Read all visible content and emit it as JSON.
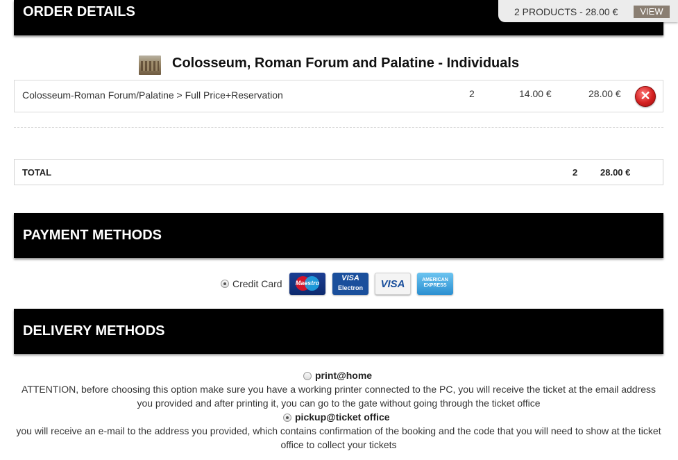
{
  "order_details": {
    "header": "ORDER DETAILS",
    "cart_summary": "2 PRODUCTS - 28.00 €",
    "view_button": "VIEW",
    "product_title": "Colosseum, Roman Forum and Palatine - Individuals",
    "line_item": {
      "description": "Colosseum-Roman Forum/Palatine > Full Price+Reservation",
      "quantity": "2",
      "unit_price": "14.00 €",
      "total": "28.00 €",
      "remove_icon": "remove-x-icon"
    },
    "totals": {
      "label": "TOTAL",
      "quantity": "2",
      "amount": "28.00 €"
    }
  },
  "payment_methods": {
    "header": "PAYMENT METHODS",
    "option_label": "Credit Card",
    "selected": true,
    "cards": [
      {
        "name": "Maestro",
        "text": "Maestro"
      },
      {
        "name": "Visa Electron",
        "text_top": "VISA",
        "text_bottom": "Electron"
      },
      {
        "name": "Visa",
        "text": "VISA"
      },
      {
        "name": "American Express",
        "text": "AMERICAN EXPRESS"
      }
    ]
  },
  "delivery_methods": {
    "header": "DELIVERY METHODS",
    "options": [
      {
        "label": "print@home",
        "selected": false,
        "description": "ATTENTION, before choosing this option make sure you have a working printer connected to the PC, you will receive the ticket at the email address you provided and after printing it, you can go to the gate without going through the ticket office"
      },
      {
        "label": "pickup@ticket office",
        "selected": true,
        "description": "you will receive an e-mail to the address you provided, which contains confirmation of the booking and the code that you will need to show at the ticket office to collect your tickets"
      }
    ]
  },
  "colors": {
    "header_bg": "#000000",
    "view_button_bg": "#8a7e72",
    "remove_red": "#d32020"
  }
}
